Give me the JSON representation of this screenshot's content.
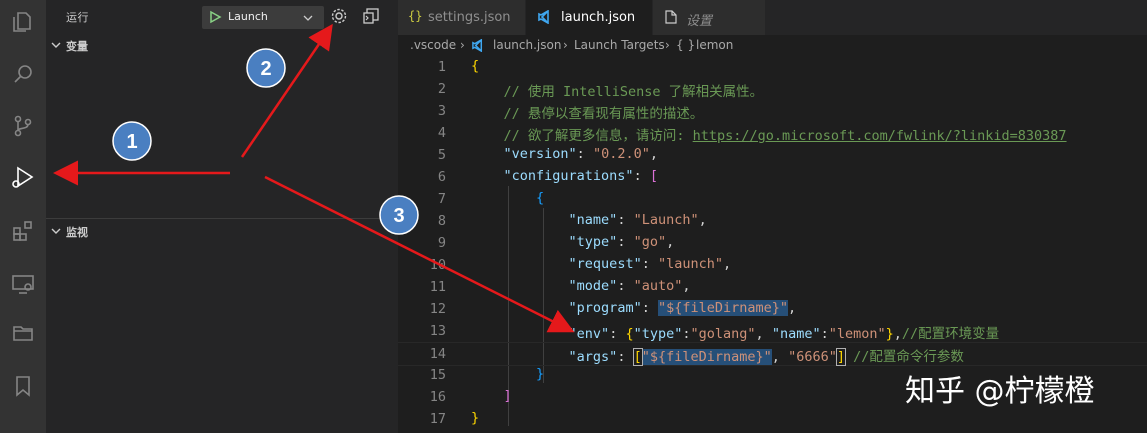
{
  "activity_bar": {
    "icons": [
      "explorer-icon",
      "search-icon",
      "source-control-icon",
      "run-debug-icon",
      "extensions-icon",
      "remote-explorer-icon",
      "folder-icon",
      "bookmark-icon"
    ]
  },
  "sidebar": {
    "title": "运行",
    "launch_config": "Launch",
    "sections": {
      "variables": "变量",
      "watch": "监视"
    }
  },
  "tabs": [
    {
      "label": "settings.json",
      "icon": "braces-icon",
      "active": false
    },
    {
      "label": "launch.json",
      "icon": "vscode-icon",
      "active": true
    },
    {
      "label": "设置",
      "icon": "file-icon",
      "active": false
    }
  ],
  "breadcrumb": {
    "folder": ".vscode",
    "file": "launch.json",
    "section": "Launch Targets",
    "item": "lemon",
    "item_prefix": "{ }"
  },
  "editor": {
    "line_numbers": [
      "1",
      "2",
      "3",
      "4",
      "5",
      "6",
      "7",
      "8",
      "9",
      "10",
      "11",
      "12",
      "13",
      "14",
      "15",
      "16",
      "17"
    ],
    "comment_1": "// 使用 IntelliSense 了解相关属性。",
    "comment_2": "// 悬停以查看现有属性的描述。",
    "comment_3": "// 欲了解更多信息，请访问: ",
    "link": "https://go.microsoft.com/fwlink/?linkid=830387",
    "version_key": "\"version\"",
    "version_val": "\"0.2.0\"",
    "configurations_key": "\"configurations\"",
    "name_key": "\"name\"",
    "name_val": "\"Launch\"",
    "type_key": "\"type\"",
    "type_val": "\"go\"",
    "request_key": "\"request\"",
    "request_val": "\"launch\"",
    "mode_key": "\"mode\"",
    "mode_val": "\"auto\"",
    "program_key": "\"program\"",
    "program_val": "\"${fileDirname}\"",
    "env_key": "\"env\"",
    "env_type_key": "\"type\"",
    "env_type_val": "\"golang\"",
    "env_name_key": "\"name\"",
    "env_name_val": "\"lemon\"",
    "env_comment": "//配置环境变量",
    "args_key": "\"args\"",
    "args_val_a": "\"${",
    "args_val_b": "fileDirname}\"",
    "args_val_2": "\"6666\"",
    "args_comment": " //配置命令行参数"
  },
  "annotations": {
    "badge_1": "1",
    "badge_2": "2",
    "badge_3": "3",
    "arrow_color": "#e5191b",
    "badge_color": "#4a7fc1"
  },
  "watermark": "知乎 @柠檬橙"
}
